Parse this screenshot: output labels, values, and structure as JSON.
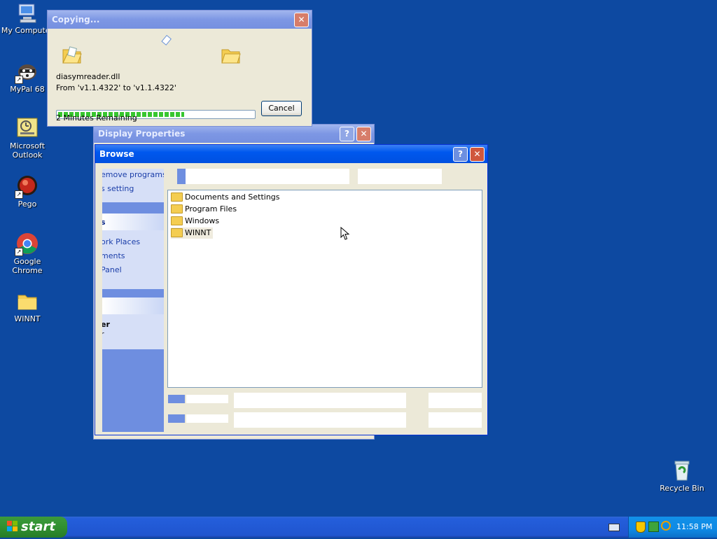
{
  "desktop": {
    "icons": [
      {
        "label": "My Computer"
      },
      {
        "label": "MyPal 68"
      },
      {
        "label": "Microsoft Outlook"
      },
      {
        "label": "Pego"
      },
      {
        "label": "Google Chrome"
      },
      {
        "label": "WINNT"
      }
    ],
    "recycle_bin": {
      "label": "Recycle Bin"
    }
  },
  "copy_dialog": {
    "title": "Copying...",
    "filename": "diasymreader.dll",
    "from_to": "From 'v1.1.4322' to 'v1.1.4322'",
    "remaining": "2 Minutes Remaining",
    "progress": 0.65,
    "cancel_label": "Cancel",
    "close_label": "✕"
  },
  "display_properties": {
    "title": "Display Properties",
    "help_label": "?",
    "close_label": "✕"
  },
  "browse": {
    "title": "Browse",
    "help_label": "?",
    "close_label": "✕",
    "sidebar_items": [
      "emove programs",
      "s setting",
      "s",
      "ork Places",
      "ments",
      "Panel",
      "er",
      "r"
    ],
    "folders": [
      "Documents and Settings",
      "Program Files",
      "Windows",
      "WINNT"
    ]
  },
  "taskbar": {
    "start_label": "start",
    "clock": "11:58 PM"
  },
  "colors": {
    "desktop": "#0d49a1",
    "titlebar_active": "#0058ee",
    "progress": "#37c62f"
  }
}
